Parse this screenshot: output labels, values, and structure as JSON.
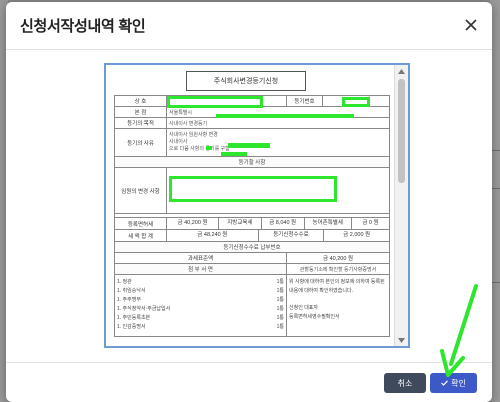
{
  "modal": {
    "title": "신청서작성내역 확인"
  },
  "document": {
    "title": "주식회사변경등기신청",
    "rows": {
      "reception_label": "접 수",
      "registry_number_label": "등기번호",
      "applicant_label": "상 호",
      "headquarters_label": "본 점",
      "headquarters_value": "서울특별시",
      "registration_purpose_label": "등기의 목적",
      "registration_purpose_value": "사내이사 변경등기",
      "registration_reason_label": "등기의 사유",
      "registration_reason_value_1": "사내이사 임원사항 변경",
      "registration_reason_value_2": "사내이사",
      "registration_reason_value_3": "이사회의 결의로 인하여 이 사건 등기를 신청함",
      "registration_reason_value_4": "으로 다음 사항의 등기를 구함",
      "registration_items_header": "등기할 사항",
      "registration_items_label": "임원의 변경 사항",
      "registration_tax_label": "등록면허세",
      "registration_tax_value": "금 40,200 원",
      "local_edu_tax_label": "지방교육세",
      "local_edu_tax_value": "금 8,040 원",
      "rural_tax_label": "농어촌특별세",
      "rural_tax_value": "금 0 원",
      "tax_total_label": "세 액 합 계",
      "tax_total_value": "금 48,240 원",
      "court_fee_label": "등기신청수수료",
      "court_fee_value": "금 2,000 원",
      "fee_payment_header": "등기신청수수료 납부번호",
      "fee_payment_number_label": "과세표준액",
      "fee_payment_number_value": "금 40,200 원",
      "attachments_header": "첨 부 서 면",
      "attachment_note": "관할등기소에 확인할 등기사항증명서",
      "attachments": [
        "1. 정관",
        "1. 취임승낙서",
        "1. 주주명부",
        "1. 주식청약서·주금납입서",
        "1. 주민등록초본",
        "1. 인감증명서"
      ],
      "attachment_counts": [
        "1통",
        "1통",
        "1통",
        "1통",
        "1통",
        "1통"
      ],
      "notice_text": "위 사항에 대하여 본인의 정보에 의하여 등록된 내용에 대하여 확인하였습니다.",
      "confirm_text": "신청인 대표자",
      "seal_text": "등록면허세영수필확인서"
    }
  },
  "footer": {
    "cancel_label": "취소",
    "confirm_label": "확인"
  }
}
